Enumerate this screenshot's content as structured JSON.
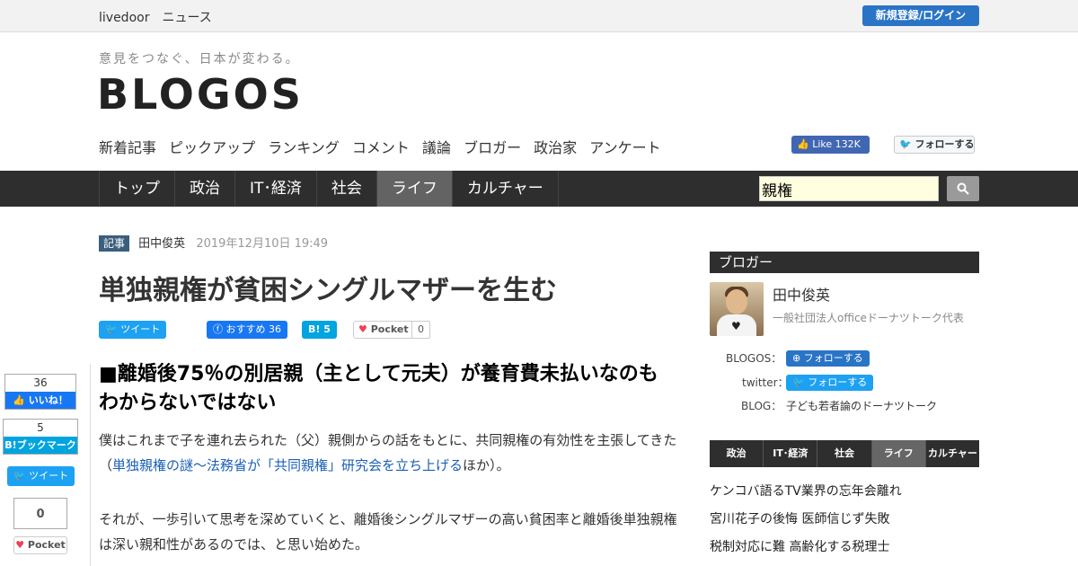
{
  "topbar": {
    "brand": "livedoor　ニュース",
    "login_label": "新規登録/ログイン"
  },
  "site": {
    "tagline": "意見をつなぐ、日本が変わる。",
    "logo": "BLOGOS"
  },
  "subnav": {
    "items": [
      "新着記事",
      "ピックアップ",
      "ランキング",
      "コメント",
      "議論",
      "ブロガー",
      "政治家",
      "アンケート"
    ]
  },
  "social": {
    "fb_like_label": "Like",
    "fb_like_count": "132K",
    "tw_follow_label": "フォローする"
  },
  "mainnav": {
    "items": [
      "トップ",
      "政治",
      "IT･経済",
      "社会",
      "ライフ",
      "カルチャー"
    ],
    "active": "ライフ"
  },
  "search": {
    "value": "親権"
  },
  "article": {
    "tag": "記事",
    "author": "田中俊英",
    "date": "2019年12月10日 19:49",
    "title": "単独親権が貧困シングルマザーを生む",
    "share": {
      "tweet_label": "ツイート",
      "fb_label": "おすすめ",
      "fb_count": "36",
      "hb_label": "B!",
      "hb_count": "5",
      "pocket_label": "Pocket",
      "pocket_count": "0"
    },
    "heading": "■離婚後75％の別居親（主として元夫）が養育費未払いなのもわからないではない",
    "p1_before": "僕はこれまで子を連れ去られた（父）親側からの話をもとに、共同親権の有効性を主張してきた（",
    "p1_link": "単独親権の謎～法務省が「共同親権」研究会を立ち上げる",
    "p1_after": "ほか）。",
    "p2": "それが、一歩引いて思考を深めていくと、離婚後シングルマザーの高い貧困率と離婚後単独親権は深い親和性があるのでは、と思い始めた。"
  },
  "side_share": {
    "fb_count": "36",
    "fb_label": "いいね！",
    "hb_count": "5",
    "hb_label": "B!ブックマーク",
    "tw_label": "ツイート",
    "pocket_count": "0",
    "pocket_label": "Pocket"
  },
  "sidebar": {
    "heading": "ブロガー",
    "name": "田中俊英",
    "org": "一般社団法人officeドーナツトーク代表",
    "blogos_label": "BLOGOS：",
    "blogos_follow": "フォローする",
    "twitter_label": "twitter：",
    "twitter_follow": "フォローする",
    "blog_label": "BLOG：",
    "blog_name": "子ども若者論のドーナツトーク",
    "tabs": [
      "政治",
      "IT･経済",
      "社会",
      "ライフ",
      "カルチャー"
    ],
    "active_tab": "ライフ",
    "ranking": [
      "ケンコバ語るTV業界の忘年会離れ",
      "宮川花子の後悔 医師信じず失敗",
      "税制対応に難 高齢化する税理士"
    ]
  }
}
